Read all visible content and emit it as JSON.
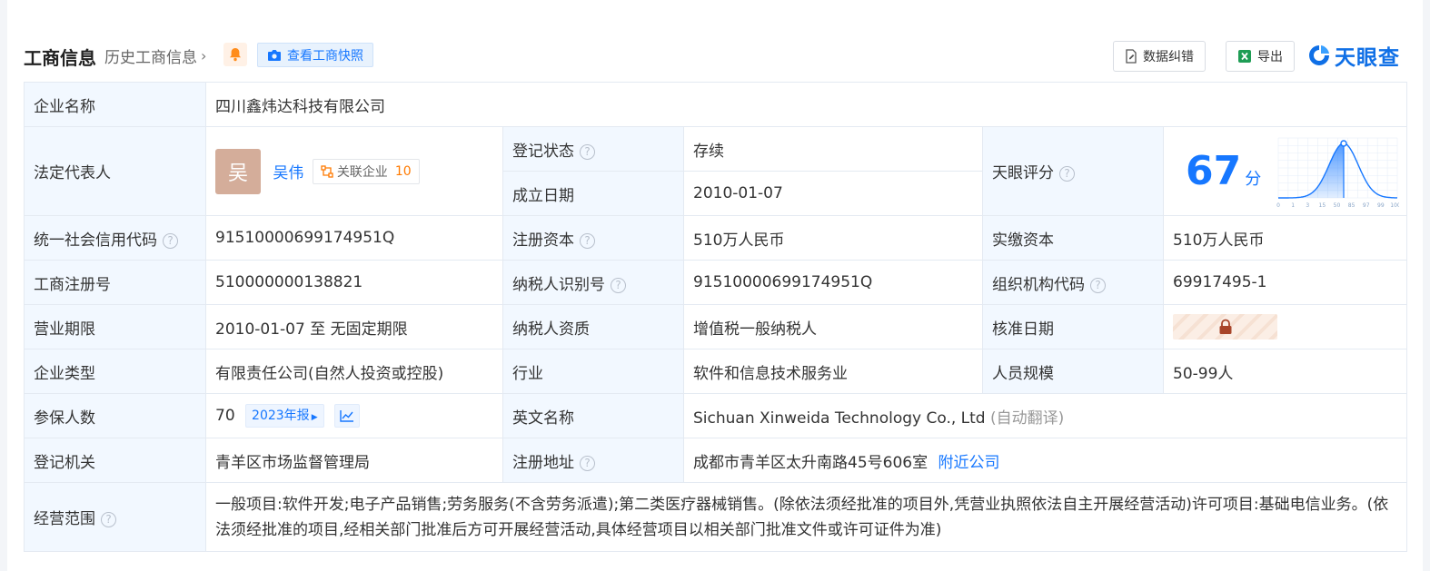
{
  "header": {
    "title": "工商信息",
    "history_link": "历史工商信息",
    "snapshot_button": "查看工商快照",
    "correct_button": "数据纠错",
    "export_button": "导出",
    "logo_text": "天眼查"
  },
  "rows": {
    "company_name": {
      "label": "企业名称",
      "value": "四川鑫炜达科技有限公司"
    },
    "legal_rep": {
      "label": "法定代表人",
      "avatar_char": "吴",
      "name": "吴伟",
      "related_label": "关联企业",
      "related_count": "10"
    },
    "reg_status": {
      "label": "登记状态",
      "value": "存续"
    },
    "found_date": {
      "label": "成立日期",
      "value": "2010-01-07"
    },
    "tianyan_score": {
      "label": "天眼评分",
      "value": "67",
      "unit": "分",
      "axis_ticks": [
        "0",
        "1",
        "3",
        "15",
        "50",
        "85",
        "97",
        "99",
        "100"
      ]
    },
    "credit_code": {
      "label": "统一社会信用代码",
      "value": "91510000699174951Q"
    },
    "reg_capital": {
      "label": "注册资本",
      "value": "510万人民币"
    },
    "paid_capital": {
      "label": "实缴资本",
      "value": "510万人民币"
    },
    "reg_number": {
      "label": "工商注册号",
      "value": "510000000138821"
    },
    "taxpayer_id": {
      "label": "纳税人识别号",
      "value": "91510000699174951Q"
    },
    "org_code": {
      "label": "组织机构代码",
      "value": "69917495-1"
    },
    "business_term": {
      "label": "营业期限",
      "value": "2010-01-07 至 无固定期限"
    },
    "taxpayer_qual": {
      "label": "纳税人资质",
      "value": "增值税一般纳税人"
    },
    "approval_date": {
      "label": "核准日期"
    },
    "company_type": {
      "label": "企业类型",
      "value": "有限责任公司(自然人投资或控股)"
    },
    "industry": {
      "label": "行业",
      "value": "软件和信息技术服务业"
    },
    "staff_size": {
      "label": "人员规模",
      "value": "50-99人"
    },
    "insured": {
      "label": "参保人数",
      "value": "70",
      "report_tag": "2023年报"
    },
    "english_name": {
      "label": "英文名称",
      "value": "Sichuan Xinweida Technology Co., Ltd",
      "note": "(自动翻译)"
    },
    "reg_authority": {
      "label": "登记机关",
      "value": "青羊区市场监督管理局"
    },
    "reg_address": {
      "label": "注册地址",
      "value": "成都市青羊区太升南路45号606室",
      "link": "附近公司"
    },
    "scope": {
      "label": "经营范围",
      "value": "一般项目:软件开发;电子产品销售;劳务服务(不含劳务派遣);第二类医疗器械销售。(除依法须经批准的项目外,凭营业执照依法自主开展经营活动)许可项目:基础电信业务。(依法须经批准的项目,经相关部门批准后方可开展经营活动,具体经营项目以相关部门批准文件或许可证件为准)"
    }
  },
  "colors": {
    "label_bg": "#f2f8ff",
    "accent": "#1677ff",
    "status_green": "#1aa34a",
    "count_orange": "#ff7a00"
  }
}
